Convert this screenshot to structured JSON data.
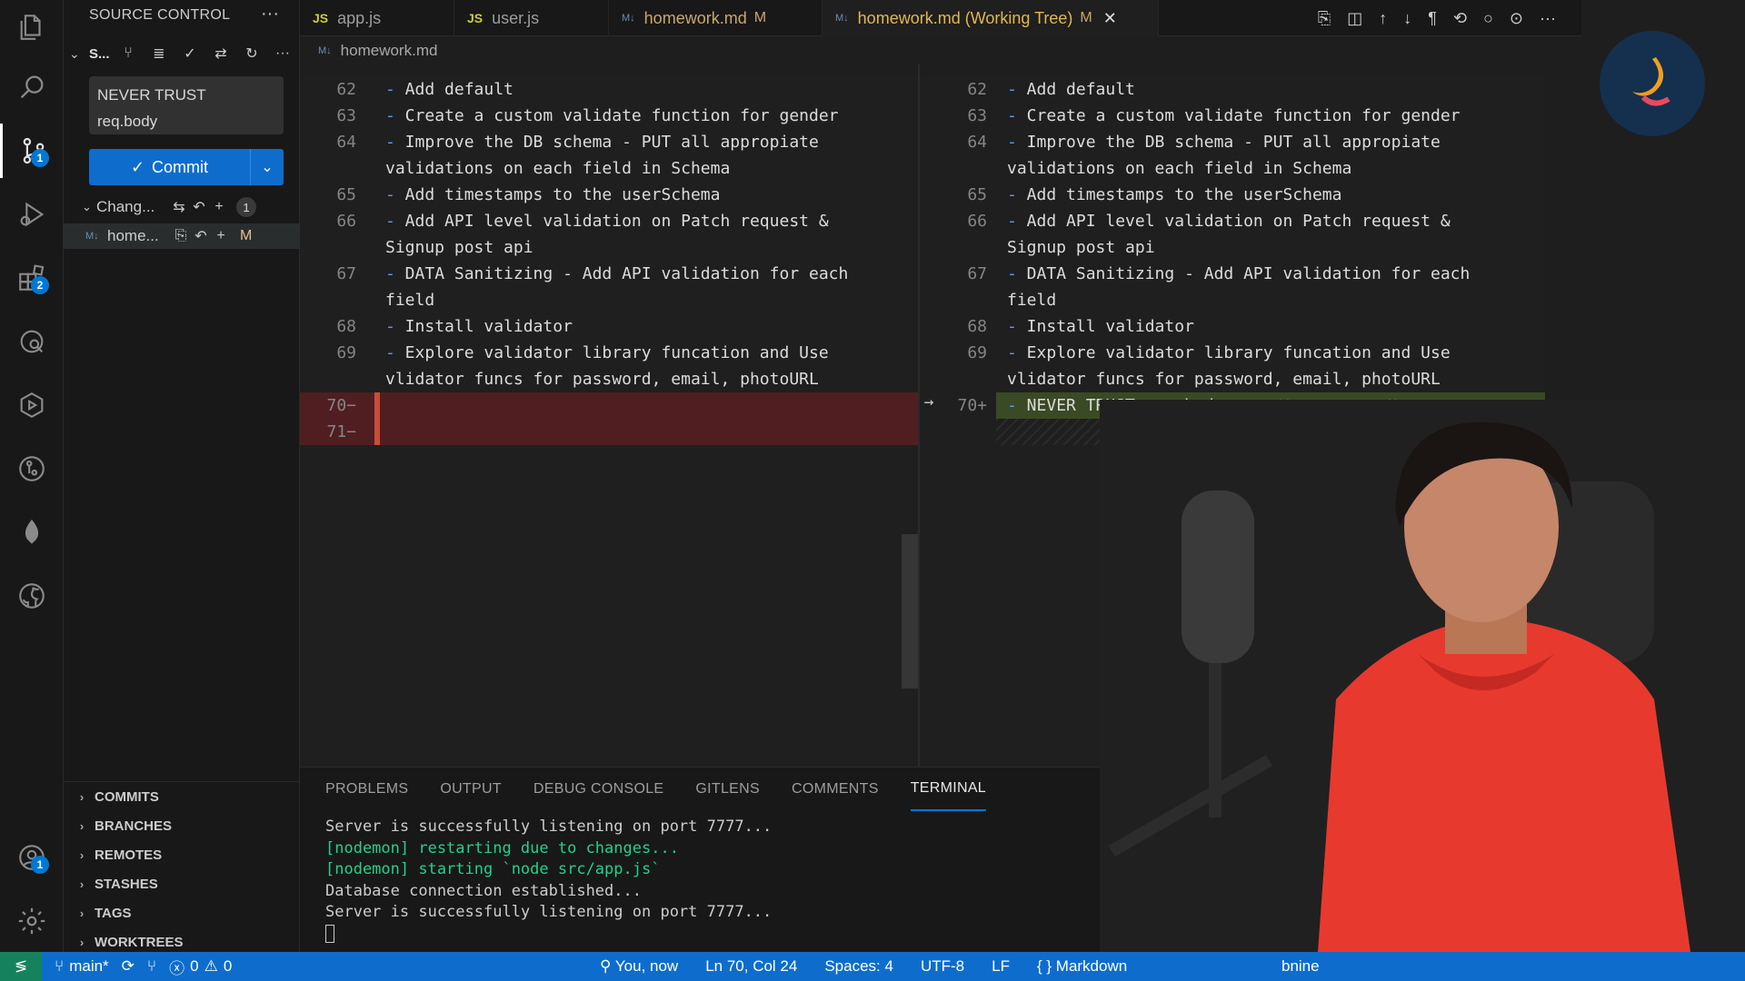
{
  "sidebar": {
    "title": "SOURCE CONTROL",
    "repo_short": "S...",
    "commit_message": "NEVER TRUST\nreq.body",
    "commit_label": "Commit",
    "changes_label": "Chang...",
    "changes_count": "1",
    "file": {
      "name": "home...",
      "status": "M"
    },
    "sections": [
      "COMMITS",
      "BRANCHES",
      "REMOTES",
      "STASHES",
      "TAGS",
      "WORKTREES"
    ]
  },
  "activity": {
    "scm_badge": "1",
    "ext_badge": "2",
    "account_badge": "1"
  },
  "tabs": [
    {
      "icon": "JS",
      "label": "app.js",
      "mod": ""
    },
    {
      "icon": "JS",
      "label": "user.js",
      "mod": ""
    },
    {
      "icon": "M↓",
      "label": "homework.md",
      "mod": "M"
    },
    {
      "icon": "M↓",
      "label": "homework.md (Working Tree)",
      "mod": "M"
    }
  ],
  "breadcrumb": "homework.md",
  "left_lines": [
    {
      "n": "62",
      "t": "- Add default"
    },
    {
      "n": "63",
      "t": "- Create a custom validate function for gender"
    },
    {
      "n": "64",
      "t": "- Improve the DB schema - PUT all appropiate"
    },
    {
      "n": "",
      "t": "validations on each field in Schema"
    },
    {
      "n": "65",
      "t": "- Add timestamps to the userSchema"
    },
    {
      "n": "66",
      "t": "- Add API level validation on Patch request &"
    },
    {
      "n": "",
      "t": "Signup post api"
    },
    {
      "n": "67",
      "t": "- DATA Sanitizing - Add API validation for each"
    },
    {
      "n": "",
      "t": "field"
    },
    {
      "n": "68",
      "t": "- Install validator"
    },
    {
      "n": "69",
      "t": "- Explore validator library funcation and Use"
    },
    {
      "n": "",
      "t": "vlidator funcs for password, email, photoURL"
    },
    {
      "n": "70−",
      "t": ""
    },
    {
      "n": "71−",
      "t": ""
    }
  ],
  "right_lines": [
    {
      "n": "62",
      "t": "- Add default"
    },
    {
      "n": "63",
      "t": "- Create a custom validate function for gender"
    },
    {
      "n": "64",
      "t": "- Improve the DB schema - PUT all appropiate"
    },
    {
      "n": "",
      "t": "validations on each field in Schema"
    },
    {
      "n": "65",
      "t": "- Add timestamps to the userSchema"
    },
    {
      "n": "66",
      "t": "- Add API level validation on Patch request &"
    },
    {
      "n": "",
      "t": "Signup post api"
    },
    {
      "n": "67",
      "t": "- DATA Sanitizing - Add API validation for each"
    },
    {
      "n": "",
      "t": "field"
    },
    {
      "n": "68",
      "t": "- Install validator"
    },
    {
      "n": "69",
      "t": "- Explore validator library funcation and Use"
    },
    {
      "n": "",
      "t": "vlidator funcs for password, email, photoURL"
    },
    {
      "n": "70+",
      "t": "- NEVER TRUST req.body"
    }
  ],
  "blame": "You, now • Un",
  "panel_tabs": [
    "PROBLEMS",
    "OUTPUT",
    "DEBUG CONSOLE",
    "GITLENS",
    "COMMENTS",
    "TERMINAL"
  ],
  "terminal": [
    {
      "t": "Server is successfully listening on port 7777...",
      "c": "plain"
    },
    {
      "t": "[nodemon] restarting due to changes...",
      "c": "green"
    },
    {
      "t": "[nodemon] starting `node src/app.js`",
      "c": "green"
    },
    {
      "t": "Database connection established...",
      "c": "plain"
    },
    {
      "t": "Server is successfully listening on port 7777...",
      "c": "plain"
    }
  ],
  "status": {
    "branch": "main*",
    "errors": "0",
    "warnings": "0",
    "blame": "You, now",
    "position": "Ln 70, Col 24",
    "spaces": "Spaces: 4",
    "encoding": "UTF-8",
    "eol": "LF",
    "language": "Markdown",
    "extra": "bnine"
  },
  "colors": {
    "accent": "#0e6dcc",
    "deleted": "#7a1e23",
    "added": "#506e28",
    "modified": "#e2c08d"
  }
}
